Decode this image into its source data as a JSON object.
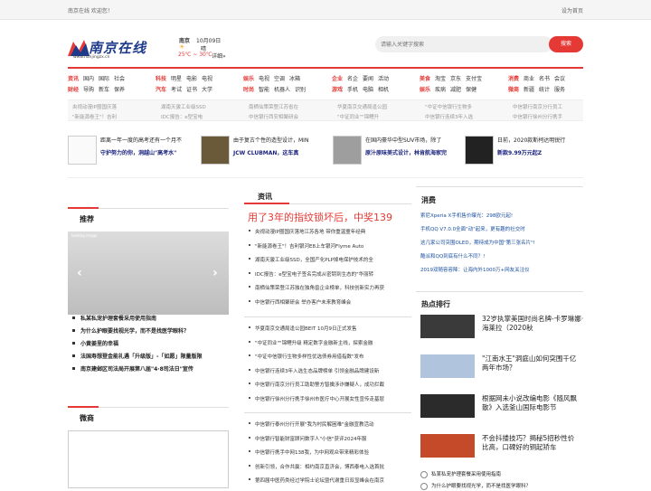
{
  "topbar": {
    "welcome": "南京在线 欢迎您！",
    "home": "设为首页"
  },
  "logo": {
    "name": "南京在线",
    "url": "www.nanjingzx.cn"
  },
  "weather": {
    "city": "南京",
    "date": "10月09日",
    "cond": "晴",
    "temp": "25℃ ~ 30℃",
    "detail": "详细»"
  },
  "search": {
    "placeholder": "请输入关键字搜索",
    "button": "搜索"
  },
  "nav": [
    {
      "row1": [
        "资讯",
        "国内",
        "国际",
        "社会"
      ],
      "row2": [
        "财经",
        "导购",
        "新车",
        "保养"
      ]
    },
    {
      "row1": [
        "科技",
        "明星",
        "电影",
        "电视"
      ],
      "row2": [
        "汽车",
        "考试",
        "证书",
        "大学"
      ]
    },
    {
      "row1": [
        "娱乐",
        "电视",
        "空调",
        "冰箱"
      ],
      "row2": [
        "时尚",
        "智能",
        "机器人",
        "识别"
      ]
    },
    {
      "row1": [
        "企业",
        "名企",
        "要闻",
        "活动"
      ],
      "row2": [
        "游戏",
        "手机",
        "电脑",
        "相机"
      ]
    },
    {
      "row1": [
        "美食",
        "淘宝",
        "京东",
        "支付宝"
      ],
      "row2": [
        "娱乐",
        "疾病",
        "减肥",
        "保健"
      ]
    },
    {
      "row1": [
        "消费",
        "商业",
        "名书",
        "会议"
      ],
      "row2": [
        "微商",
        "新疆",
        "统计",
        "服务"
      ]
    }
  ],
  "hotlinks": [
    "央视动漫IP圈国庆落",
    "湖南天骏工业级SSD",
    "南栖仙策荣登江苏省在",
    "华夏南京交通局逢公园",
    "\"中证中信银行生物多",
    "中信银行南京分行员工",
    "\"新能源卷王\"！吉利",
    "IDC报告：e型宝电",
    "中信银行西安相聚研会",
    "\"中证同业\"\"锦鲤升",
    "中信银行连续3年入选",
    "中信银行徐州分行携手"
  ],
  "features": [
    {
      "t1": "距离一年一度的高考还有一个月不",
      "t2": "守护努力的你，洞越山\"高考水\""
    },
    {
      "t1": "由于复古个性的造型设计，MIN",
      "t2": "JCW CLUBMAN，这车真"
    },
    {
      "t1": "在国内豪华中型SUV市场，除了",
      "t2": "原汁原味美式设计，林肯航海家完"
    },
    {
      "t1": "日前，2020款斯柯达明锐行",
      "t2": "新款9.99万元起Z"
    }
  ],
  "sections": {
    "recommend": "推荐",
    "news": "资讯",
    "consume": "消费",
    "hot": "热点排行",
    "weishang": "微商"
  },
  "slider": {
    "caption": "loading image"
  },
  "recommend_list": [
    "私某私宠护理套餐采用使用指南",
    "为什么护眼要找视光学，而不是找医学眼科？",
    "小黄姜里的幸福",
    "法国寿想登金能礼遇「升级版」-「如愿」限量版限",
    "南京建邺区司法局开展第八届\"4·8司法日\"宣传"
  ],
  "center_title": "用了3年的指纹锁坏后，中奖139",
  "center_list_1": [
    "央视动漫IP圈国庆落地江苏各地 带你重温童年经典",
    "\"新能源卷王\"！吉利银河E8上车银河Flyme Auto",
    "湖南天骏工业级SSD，全国产化PLP掉电保护技术的全",
    "IDC报告：e型宝电子签名完成从密钥到生态的\"华丽转",
    "南栖仙策荣登江苏独在独角兽企业榜单，科技创新实力再获",
    "中信银行西相聚研会 举办客户未来教育峰会"
  ],
  "center_list_2": [
    "华夏南京交通局逢公园BEIT 10月9日正式发售",
    "\"中证同业\"\"锦鲤升级 精定数字金融新主线，探索金融",
    "\"中证中信银行生物多样性优选债券用借指数\"发布",
    "中信银行连续3年入选生态品牌榜单 引领金融品牌建设新",
    "中信银行南京分行员工助助警方智擒涉诈嫌疑人，成功拦截",
    "中信银行徐州分行携手徐州市医疗中心开展女性宣传走基层"
  ],
  "center_list_3": [
    "中信银行泰州分行开展\"我为村民解困难\"金融宣教活动",
    "中信银行智能财富顾问数字人\"小信\"获评2024年服",
    "中信银行携手中网138我，为中网观众带来精彩体验",
    "创新引领，合作共赢：相约南京直济会，博西泰电入选首批",
    "第四届中医药类经过学院士论坛暨代谢重日双显峰会在南京"
  ],
  "consume_list": [
    "索尼Xperia X手机售价曝光：298欧元起!",
    "手机QQ V7.0.0全面\"动\"起来，更有趣的社交时",
    "这几家公司突围OLED，期待成为中国\"第三张名片\"!",
    "酷派和QQ到底有什么不同？!",
    "2019双随容容降：让海内外1000万+网友关注仪"
  ],
  "hot_list": [
    {
      "line1": "32岁执掌美国时尚名牌-卡罗琳娜·",
      "line2": "海莱拉（2020秋"
    },
    {
      "line1": "\"江南水王\"洞庭山如何突围千亿",
      "line2": "两年市场？"
    },
    {
      "line1": "根据网未小说改编电影《随风飘",
      "line2": "散》入选釜山国际电影节"
    },
    {
      "line1": "不会抖搂技巧？揭秘5招秒性价",
      "line2": "比高，口碑好的铜起矫车"
    }
  ],
  "bottom_list": [
    "私某私宠护理套餐采用使用指南",
    "为什么护眼要找视光学，而不是找医学眼科？"
  ]
}
